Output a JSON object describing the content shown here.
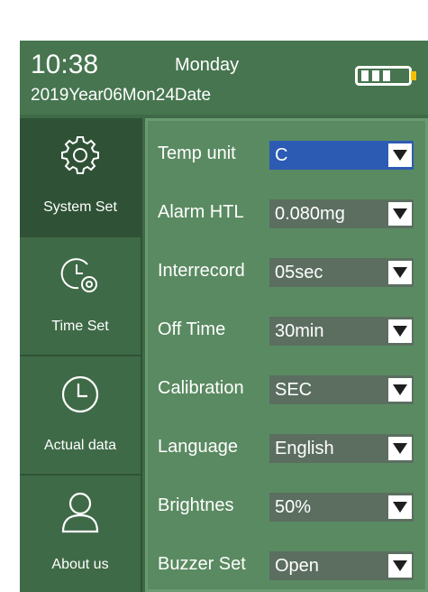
{
  "status": {
    "time": "10:38",
    "weekday": "Monday",
    "date": "2019Year06Mon24Date"
  },
  "sidebar": {
    "items": [
      {
        "label": "System Set",
        "icon": "gear-icon",
        "active": true
      },
      {
        "label": "Time Set",
        "icon": "clock-gear-icon",
        "active": false
      },
      {
        "label": "Actual data",
        "icon": "clock-icon",
        "active": false
      },
      {
        "label": "About us",
        "icon": "user-icon",
        "active": false
      }
    ]
  },
  "settings": [
    {
      "label": "Temp unit",
      "value": "C"
    },
    {
      "label": "Alarm HTL",
      "value": "0.080mg"
    },
    {
      "label": "Interrecord",
      "value": "05sec"
    },
    {
      "label": "Off Time",
      "value": "30min"
    },
    {
      "label": "Calibration",
      "value": "SEC"
    },
    {
      "label": "Language",
      "value": "English"
    },
    {
      "label": "Brightnes",
      "value": "50%"
    },
    {
      "label": "Buzzer Set",
      "value": "Open"
    }
  ],
  "colors": {
    "background": "#3f6a47",
    "panel": "#5a8a61",
    "dropdown": "#5b6e60",
    "selected_dropdown": "#2c5bb3"
  }
}
